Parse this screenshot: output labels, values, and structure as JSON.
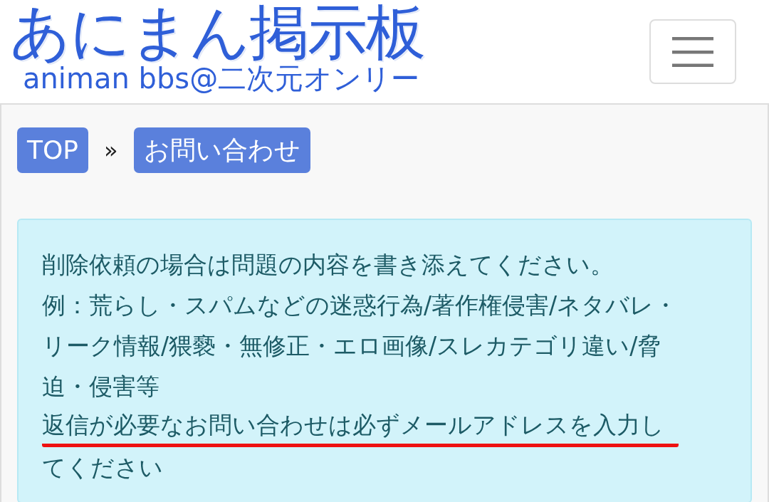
{
  "header": {
    "logo_title": "あにまん掲示板",
    "logo_subtitle": "animan bbs@二次元オンリー"
  },
  "breadcrumb": [
    {
      "label": "TOP"
    },
    {
      "label": "お問い合わせ"
    }
  ],
  "breadcrumb_separator": "»",
  "notice": {
    "lines": [
      {
        "text": "削除依頼の場合は問題の内容を書き添えてください。",
        "underlined": false
      },
      {
        "text": "例：荒らし・スパムなどの迷惑行為/著作権侵害/ネタバレ・",
        "underlined": false
      },
      {
        "text": "リーク情報/猥褻・無修正・エロ画像/スレカテゴリ違い/脅",
        "underlined": false
      },
      {
        "text": "迫・侵害等",
        "underlined": false
      },
      {
        "text": "返信が必要なお問い合わせは必ずメールアドレスを入力し",
        "underlined": true
      },
      {
        "text": "てください",
        "underlined": false
      }
    ]
  }
}
